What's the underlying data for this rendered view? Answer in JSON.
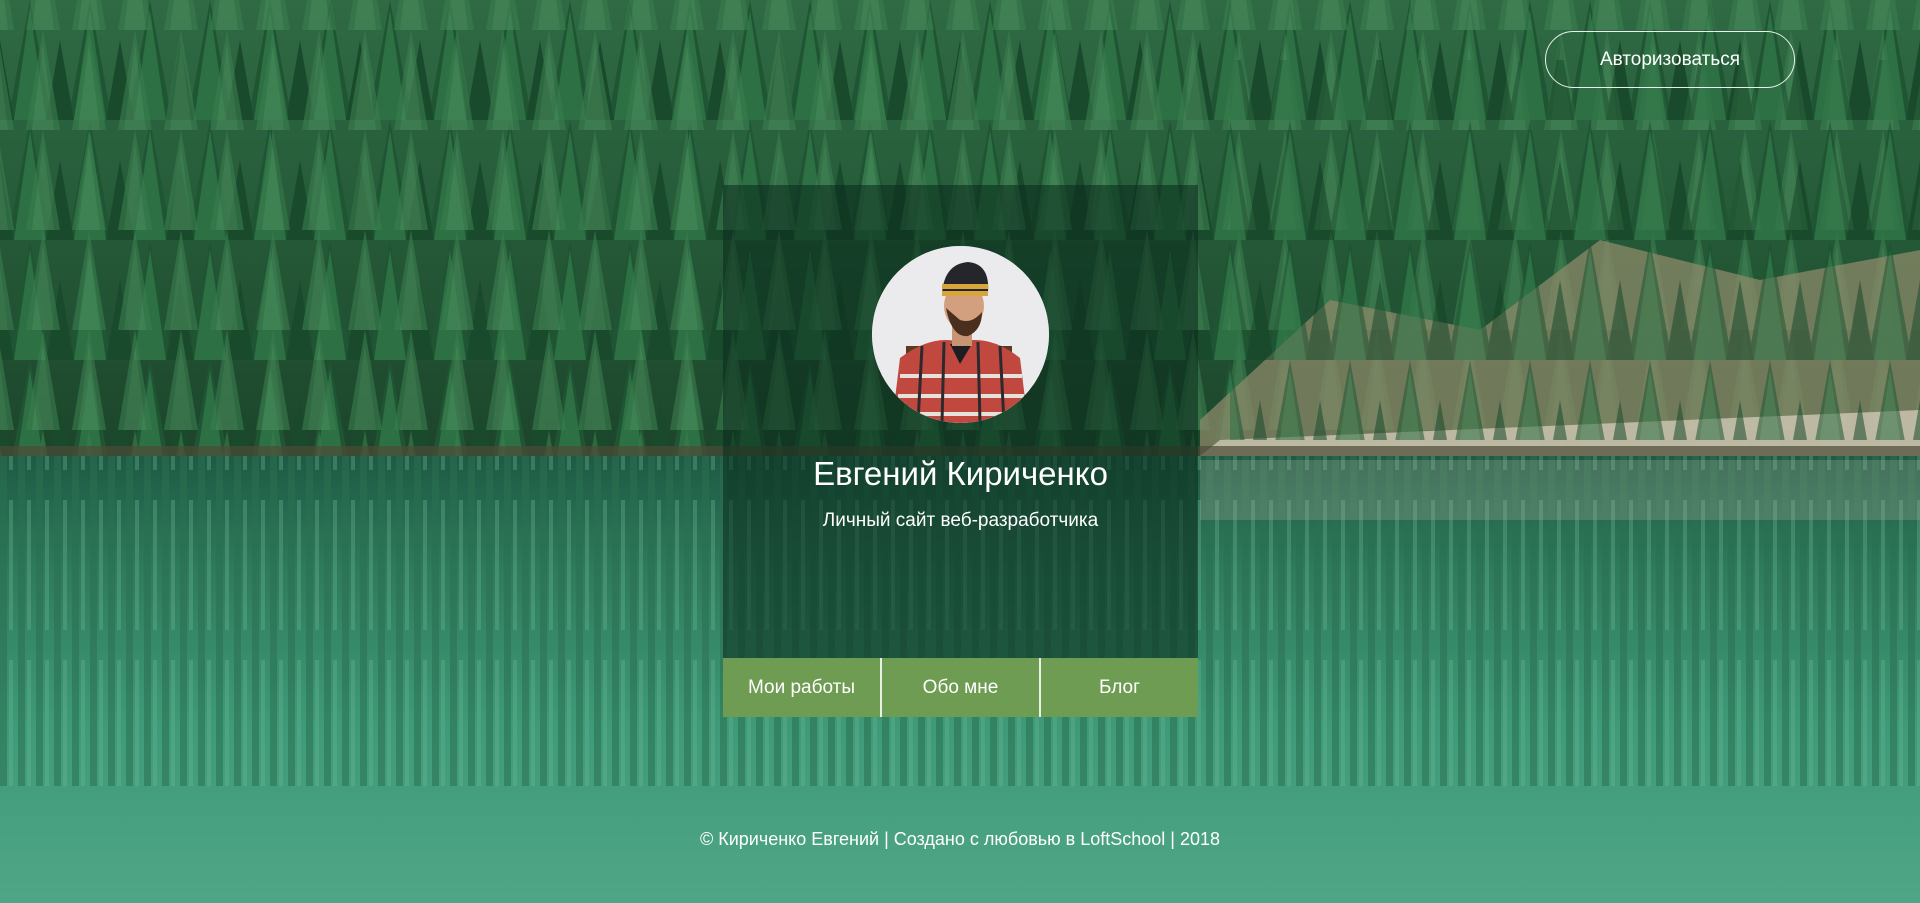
{
  "header": {
    "auth_label": "Авторизоваться"
  },
  "profile": {
    "name": "Евгений Кириченко",
    "subtitle": "Личный сайт веб-разработчика"
  },
  "nav": {
    "items": [
      {
        "label": "Мои работы"
      },
      {
        "label": "Обо мне"
      },
      {
        "label": "Блог"
      }
    ]
  },
  "footer": {
    "text": "© Кириченко Евгений | Создано с любовью в LoftSchool | 2018"
  },
  "colors": {
    "nav_button": "#6e9c52",
    "card_overlay": "rgba(10, 42, 28, 0.55)",
    "text": "#ffffff"
  }
}
